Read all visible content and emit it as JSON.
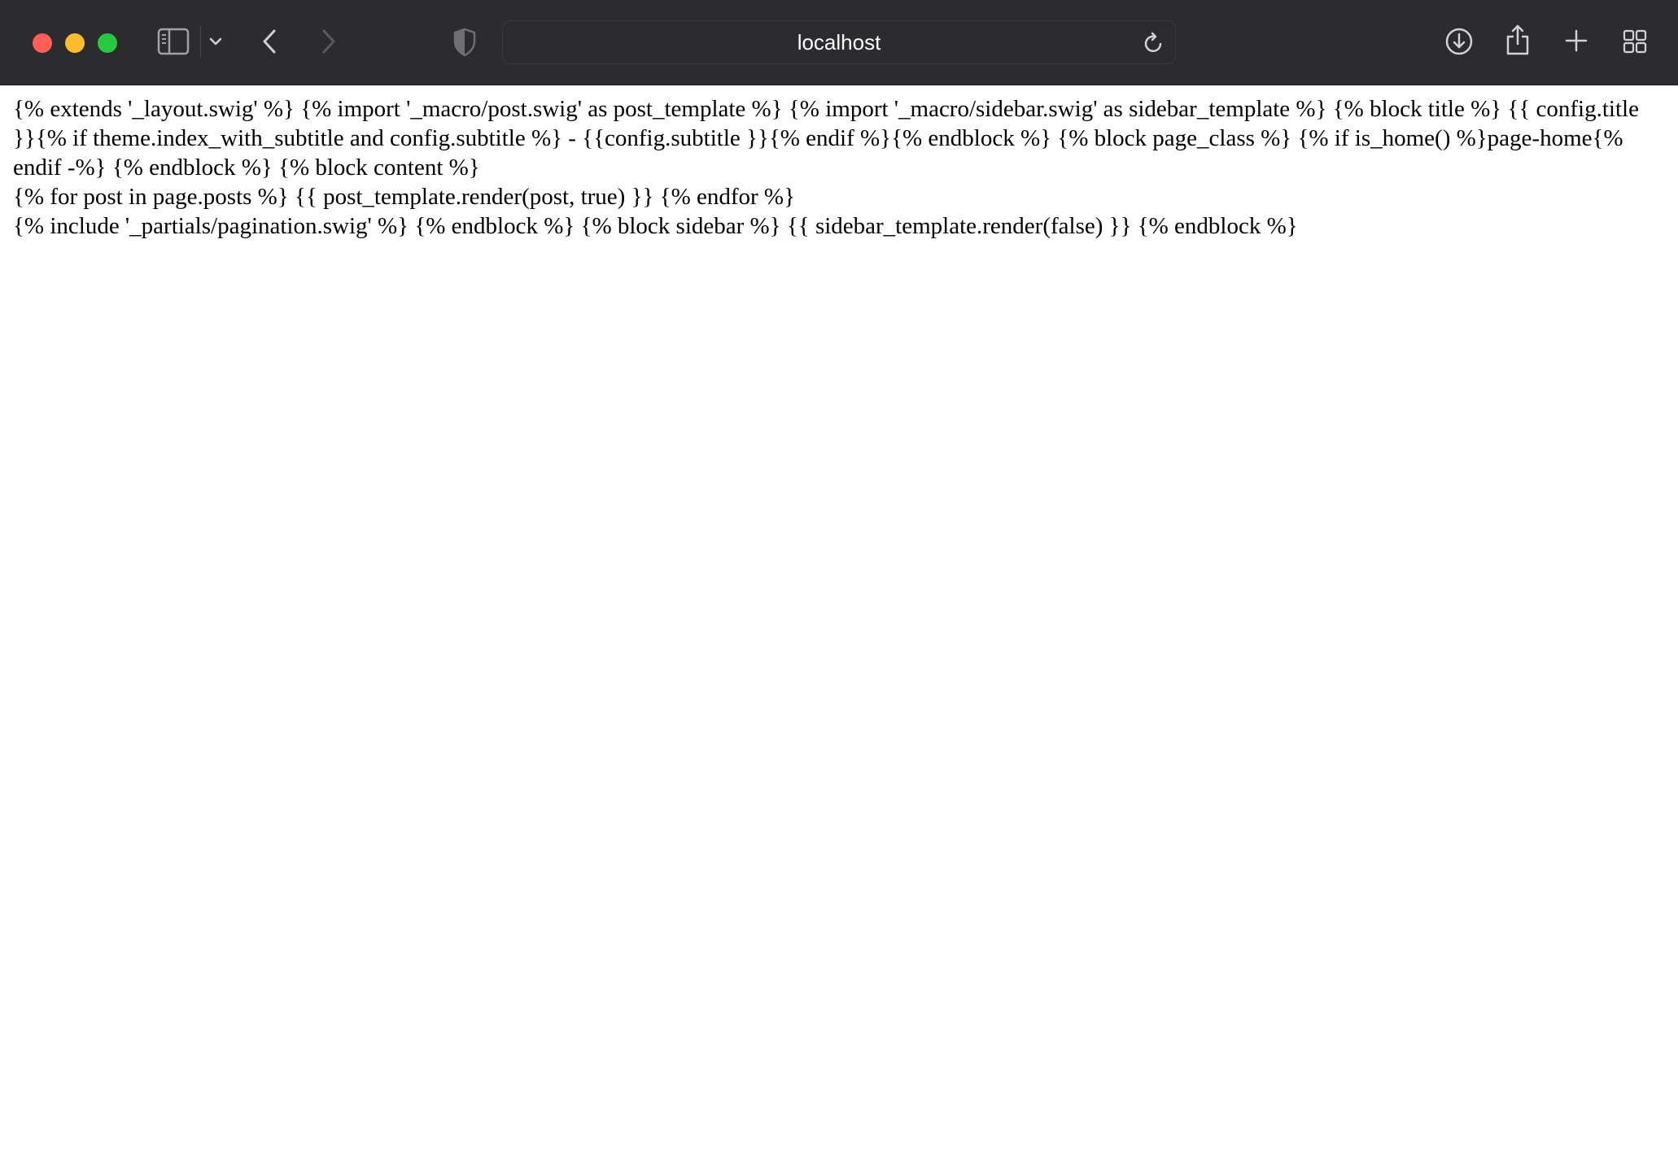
{
  "browser": {
    "address": "localhost",
    "icons": {
      "sidebar": "sidebar-icon",
      "chevron": "chevron-down-icon",
      "back": "chevron-left-icon",
      "forward": "chevron-right-icon",
      "privacy": "shield-icon",
      "reload": "reload-icon",
      "download": "download-icon",
      "share": "share-icon",
      "new_tab": "plus-icon",
      "tab_overview": "grid-icon"
    },
    "colors": {
      "toolbar": "#2c2c2e",
      "close": "#fe5f57",
      "minimize": "#febc2e",
      "maximize": "#28c840"
    }
  },
  "page": {
    "lines": [
      "{% extends '_layout.swig' %} {% import '_macro/post.swig' as post_template %} {% import '_macro/sidebar.swig' as sidebar_template %} {% block title %} {{ config.title }}{% if theme.index_with_subtitle and config.subtitle %} - {{config.subtitle }}{% endif %}{% endblock %} {% block page_class %} {% if is_home() %}page-home{% endif -%} {% endblock %} {% block content %}",
      "{% for post in page.posts %} {{ post_template.render(post, true) }} {% endfor %}",
      "{% include '_partials/pagination.swig' %} {% endblock %} {% block sidebar %} {{ sidebar_template.render(false) }} {% endblock %}"
    ]
  }
}
